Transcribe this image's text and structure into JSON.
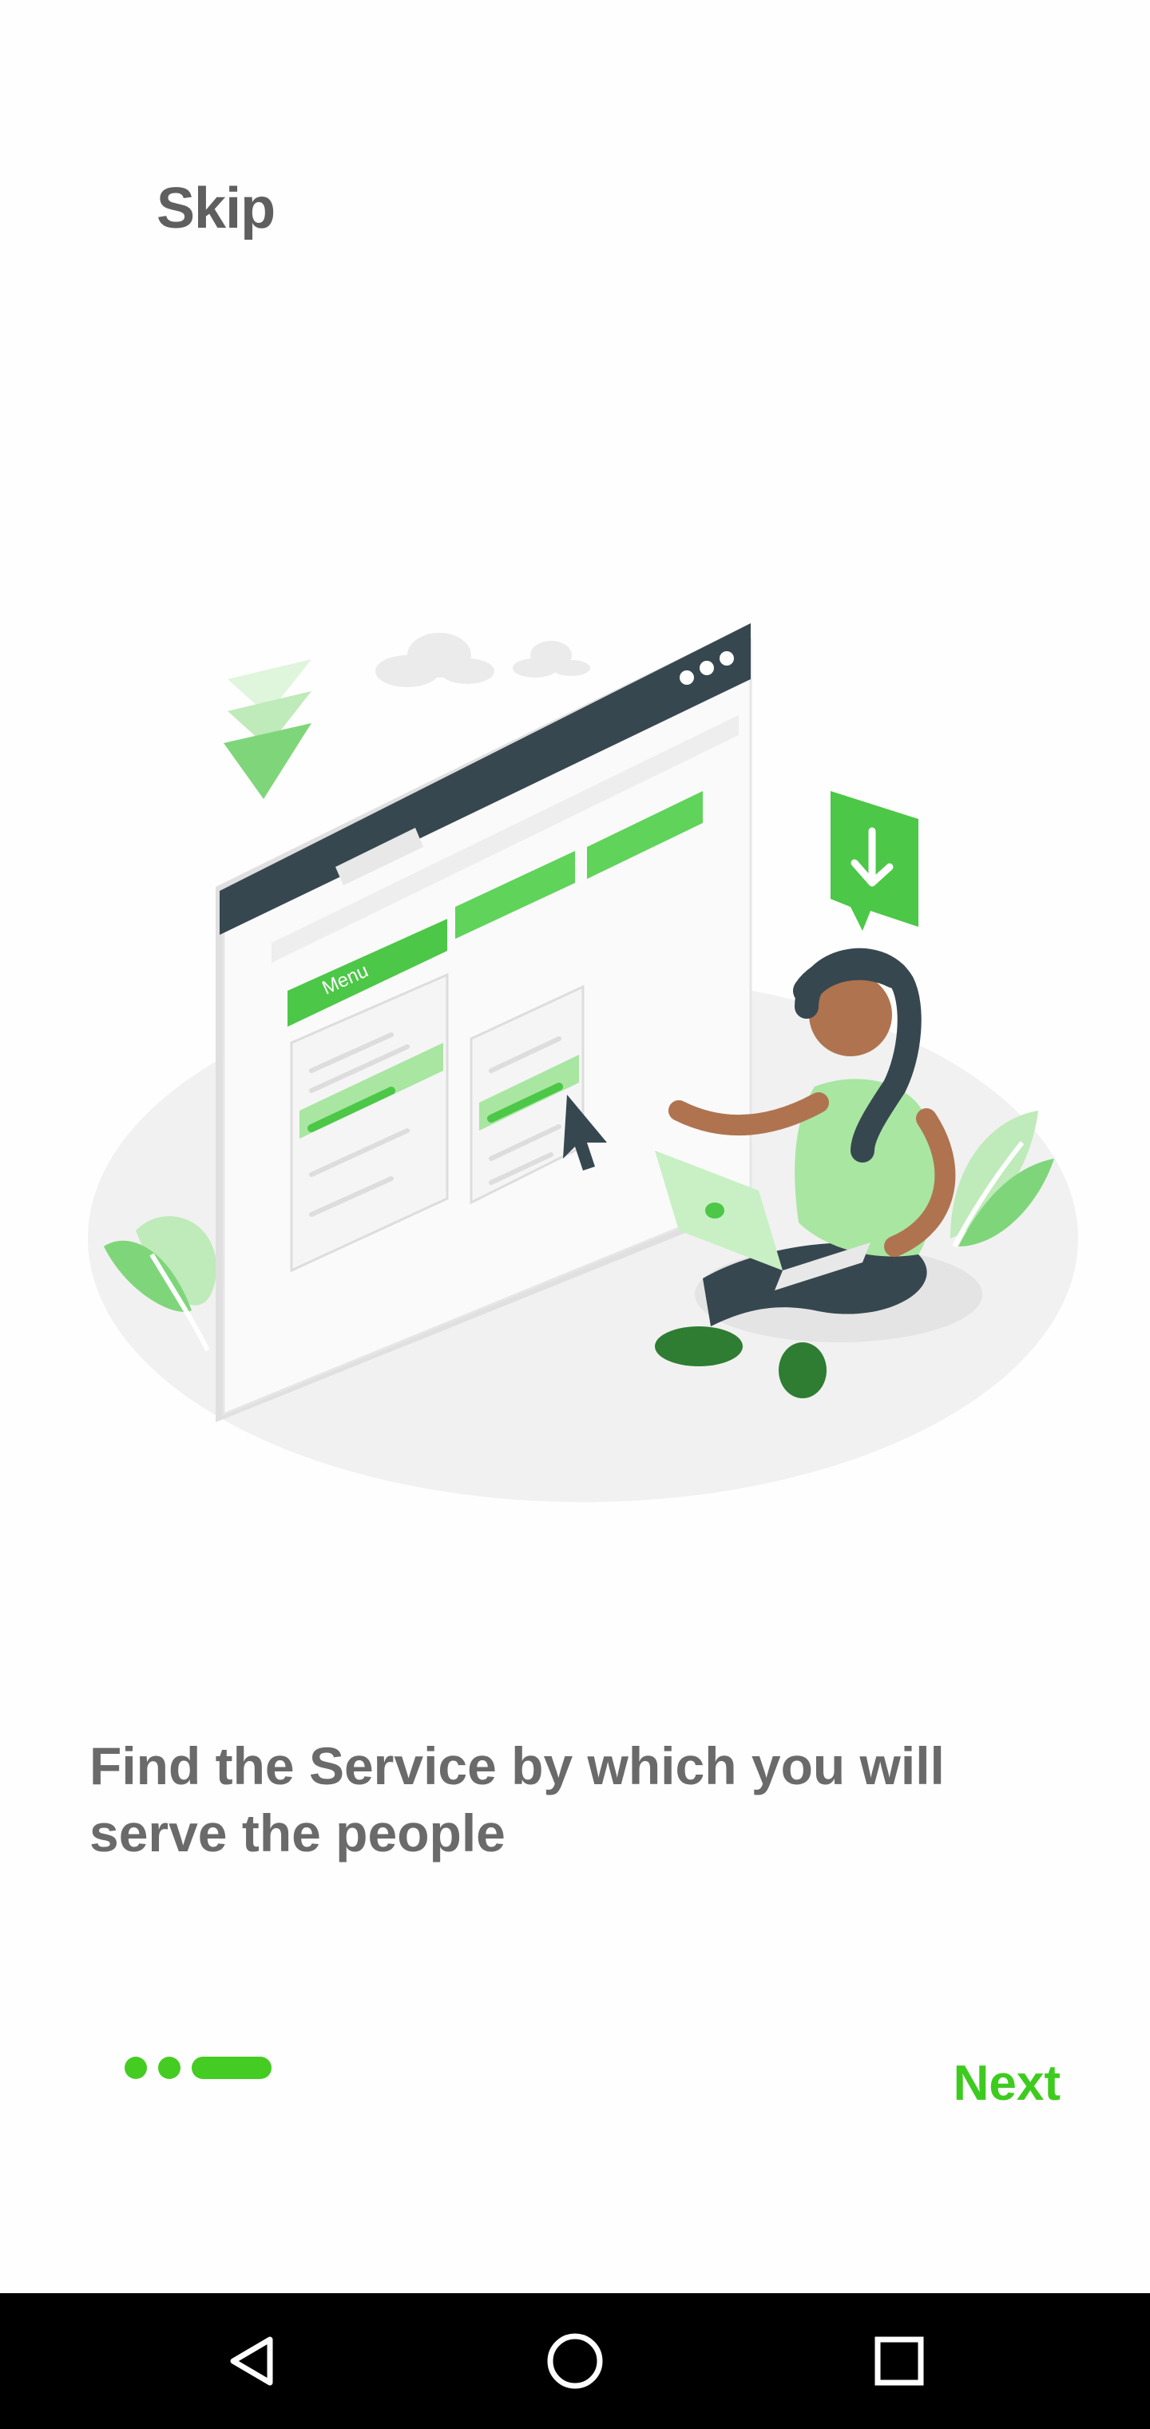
{
  "onboarding": {
    "skip_label": "Skip",
    "headline": "Find the Service by which you will serve the people",
    "next_label": "Next",
    "pages_total": 3,
    "current_page": 3
  },
  "illustration": {
    "menu_label": "Menu",
    "icon": "download-icon"
  },
  "navbar": {
    "back_icon": "back-triangle-icon",
    "home_icon": "home-circle-icon",
    "recents_icon": "recents-square-icon"
  },
  "colors": {
    "accent": "#44cc22",
    "next_text": "#3ecb1f",
    "headline_text": "#6a6a6a",
    "skip_text": "#5f5f5f"
  }
}
